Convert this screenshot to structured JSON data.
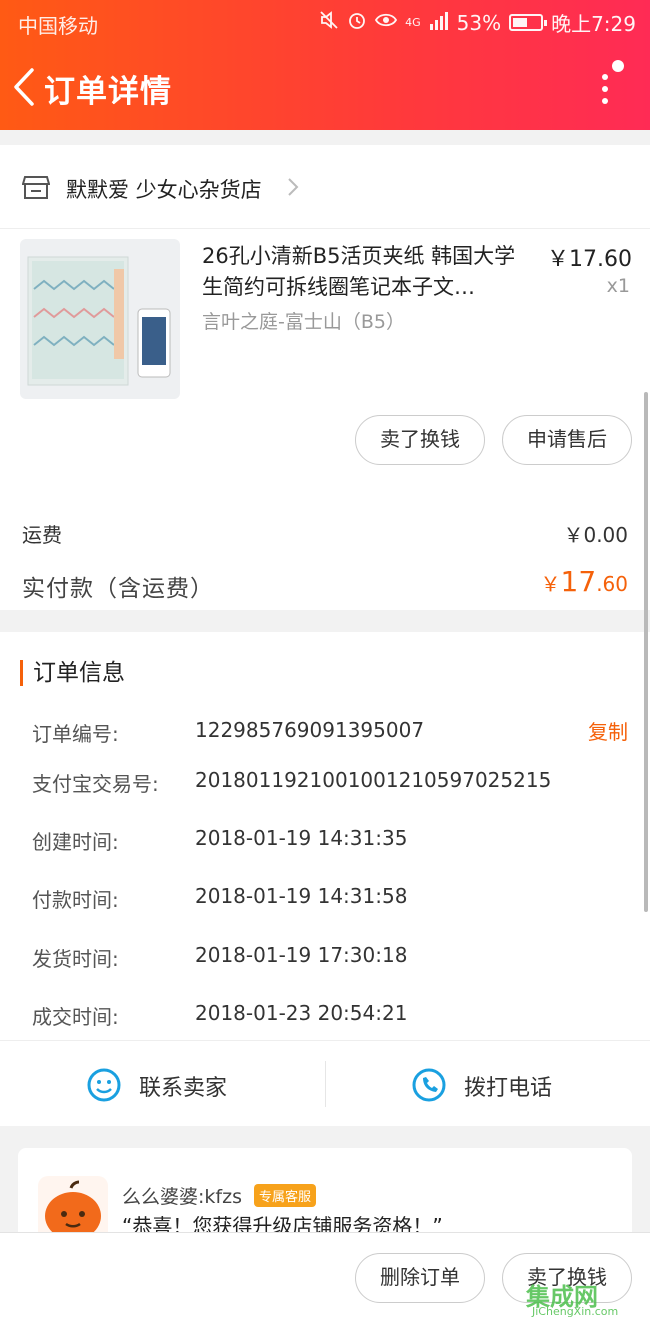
{
  "status_bar": {
    "carrier": "中国移动",
    "network": "4G",
    "battery": "53%",
    "battery_level": 0.53,
    "time": "晚上7:29",
    "icons": [
      "mute-icon",
      "alarm-icon",
      "eye-icon",
      "signal-icon",
      "battery-icon"
    ]
  },
  "header": {
    "title": "订单详情",
    "back_icon": "chevron-left-icon",
    "more_icon": "more-vertical-icon"
  },
  "shop": {
    "name": "默默爱 少女心杂货店",
    "icon": "store-icon"
  },
  "item": {
    "title": "26孔小清新B5活页夹纸 韩国大学生简约可拆线圈笔记本子文…",
    "sku": "言叶之庭-富士山（B5）",
    "price": "￥17.60",
    "quantity": "x1",
    "actions": [
      "卖了换钱",
      "申请售后"
    ]
  },
  "fees": {
    "shipping_label": "运费",
    "shipping_value": "￥0.00",
    "paid_label": "实付款（含运费）",
    "paid_currency": "￥",
    "paid_int": "17",
    "paid_dec": ".60"
  },
  "order_info": {
    "heading": "订单信息",
    "copy_label": "复制",
    "rows": [
      {
        "label": "订单编号:",
        "value": "122985769091395007"
      },
      {
        "label": "支付宝交易号:",
        "value": "2018011921001001210597025215"
      },
      {
        "label": "创建时间:",
        "value": "2018-01-19 14:31:35"
      },
      {
        "label": "付款时间:",
        "value": "2018-01-19 14:31:58"
      },
      {
        "label": "发货时间:",
        "value": "2018-01-19 17:30:18"
      },
      {
        "label": "成交时间:",
        "value": "2018-01-23 20:54:21"
      }
    ]
  },
  "contact": {
    "seller_label": "联系卖家",
    "call_label": "拨打电话"
  },
  "message": {
    "name": "么么婆婆:kfzs",
    "tag": "专属客服",
    "text": "“恭喜！您获得升级店铺服务资格！”"
  },
  "bottom_actions": {
    "delete": "删除订单",
    "sell": "卖了换钱"
  },
  "watermark": {
    "main": "集成网",
    "sub": "JiChengXin.com"
  },
  "colors": {
    "accent": "#f5610a",
    "header_start": "#ff5a14",
    "header_end": "#ff2b55",
    "contact_icon": "#1aa0e0"
  }
}
